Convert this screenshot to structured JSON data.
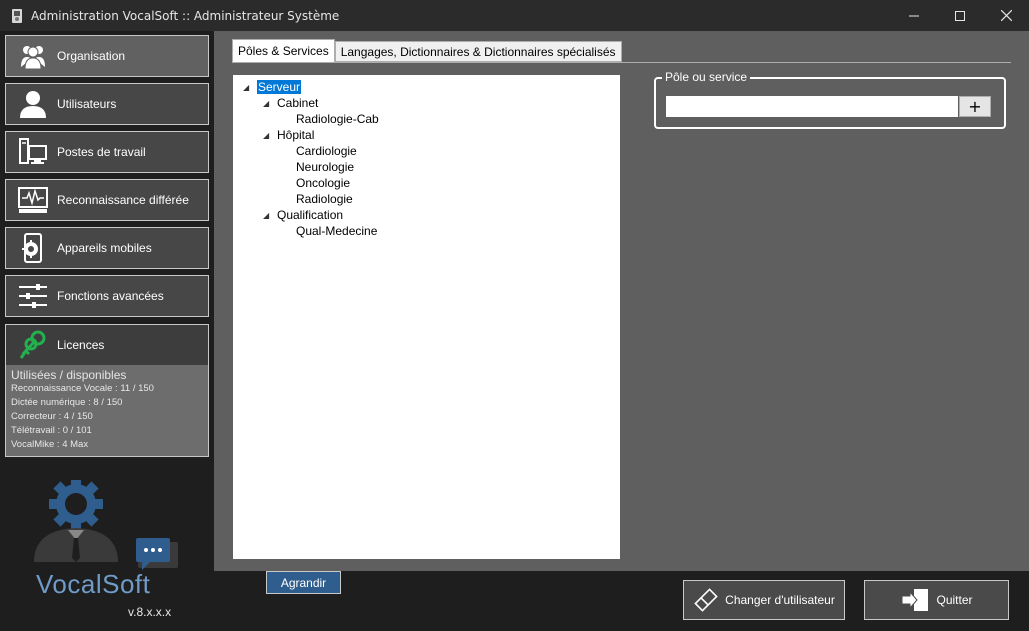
{
  "window": {
    "title": "Administration VocalSoft :: Administrateur Système",
    "minimize": "—",
    "maximize": "☐",
    "close": "✕"
  },
  "sidebar": {
    "items": [
      {
        "label": "Organisation",
        "icon": "users-icon",
        "active": true
      },
      {
        "label": "Utilisateurs",
        "icon": "user-icon",
        "active": false
      },
      {
        "label": "Postes de travail",
        "icon": "workstation-icon",
        "active": false
      },
      {
        "label": "Reconnaissance différée",
        "icon": "monitor-waveform-icon",
        "active": false
      },
      {
        "label": "Appareils mobiles",
        "icon": "mobile-gear-icon",
        "active": false
      },
      {
        "label": "Fonctions avancées",
        "icon": "sliders-icon",
        "active": false
      }
    ],
    "licences": {
      "label": "Licences",
      "icon": "keys-icon",
      "title": "Utilisées / disponibles",
      "lines": [
        "Reconnaissance Vocale : 11 / 150",
        "Dictée numérique : 8 / 150",
        "Correcteur : 4 / 150",
        "Télétravail : 0 / 101",
        "VocalMike : 4 Max"
      ]
    },
    "brand": {
      "part1": "Vocal",
      "part2": "Soft",
      "version": "v.8.x.x.x"
    }
  },
  "tabs": [
    {
      "label": "Pôles & Services",
      "active": true
    },
    {
      "label": "Langages, Dictionnaires & Dictionnaires spécialisés",
      "active": false
    }
  ],
  "tree": {
    "root": "Serveur",
    "groups": [
      {
        "label": "Cabinet",
        "children": [
          "Radiologie-Cab"
        ]
      },
      {
        "label": "Hôpital",
        "children": [
          "Cardiologie",
          "Neurologie",
          "Oncologie",
          "Radiologie"
        ]
      },
      {
        "label": "Qualification",
        "children": [
          "Qual-Medecine"
        ]
      }
    ]
  },
  "pole_group": {
    "legend": "Pôle ou service",
    "input_value": "",
    "add_label": "+"
  },
  "buttons": {
    "agrandir": "Agrandir",
    "changer": "Changer d'utilisateur",
    "quitter": "Quitter"
  },
  "colors": {
    "accent": "#2f5e8e",
    "selection": "#0078d7",
    "licence_icon": "#22b14c",
    "brand": "#6e9bc8"
  }
}
